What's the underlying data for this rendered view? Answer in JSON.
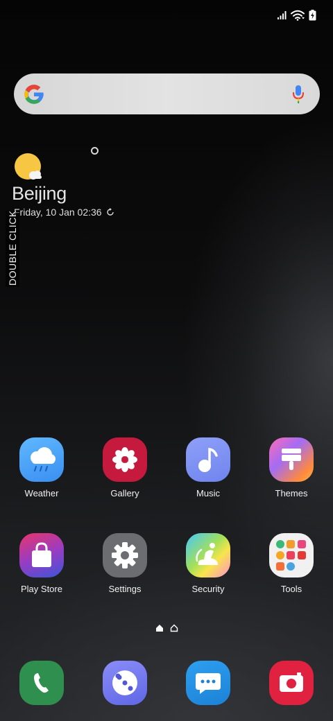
{
  "status_bar": {
    "icons": [
      "signal-icon",
      "wifi-icon",
      "battery-charging-icon"
    ]
  },
  "search": {
    "value": "",
    "placeholder": "",
    "icons": [
      "google-g-icon",
      "microphone-icon"
    ]
  },
  "weather_widget": {
    "city": "Beijing",
    "date_time": "Friday, 10 Jan 02:36",
    "icon": "sun-cloud-icon",
    "refresh_icon": "refresh-icon"
  },
  "side_label": "DOUBLE CLICK",
  "apps": [
    {
      "label": "Weather",
      "icon": "weather-app-icon"
    },
    {
      "label": "Gallery",
      "icon": "gallery-app-icon"
    },
    {
      "label": "Music",
      "icon": "music-app-icon"
    },
    {
      "label": "Themes",
      "icon": "themes-app-icon"
    },
    {
      "label": "Play Store",
      "icon": "play-store-app-icon"
    },
    {
      "label": "Settings",
      "icon": "settings-app-icon"
    },
    {
      "label": "Security",
      "icon": "security-app-icon"
    },
    {
      "label": "Tools",
      "icon": "tools-folder-icon"
    }
  ],
  "dock": [
    {
      "icon": "phone-app-icon"
    },
    {
      "icon": "internet-app-icon"
    },
    {
      "icon": "messages-app-icon"
    },
    {
      "icon": "camera-app-icon"
    }
  ],
  "page_indicator": {
    "icons": [
      "home-filled-icon",
      "home-outline-icon"
    ],
    "current_page": 1
  },
  "colors": {
    "sun": "#f7c744",
    "gallery": "#c51a3e",
    "settings": "#6b6d70",
    "phone": "#2f8f4e",
    "camera": "#e0213f",
    "messages": "#1c82d6"
  }
}
